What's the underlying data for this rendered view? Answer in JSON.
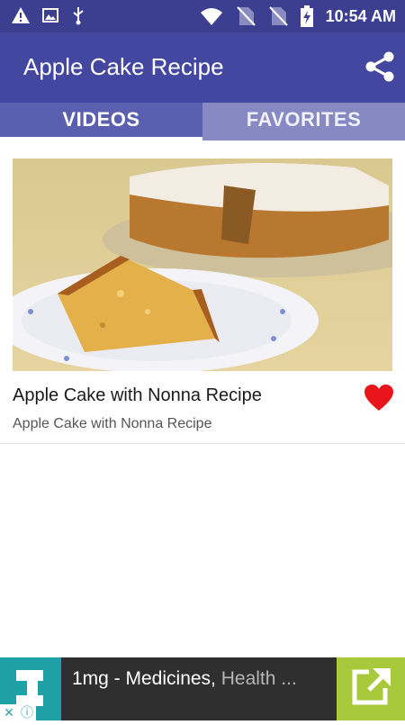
{
  "status_bar": {
    "time": "10:54 AM",
    "left_icons": [
      "alert-icon",
      "image-icon",
      "usb-icon"
    ],
    "right_icons": [
      "wifi-icon",
      "no-sim-icon",
      "no-sim-icon",
      "battery-charging-icon"
    ]
  },
  "app_bar": {
    "title": "Apple Cake Recipe",
    "share_icon": "share-icon",
    "color": "#4347a0"
  },
  "tabs": [
    {
      "label": "VIDEOS",
      "active": true
    },
    {
      "label": "FAVORITES",
      "active": false
    }
  ],
  "videos": [
    {
      "title": "Apple Cake with Nonna Recipe",
      "subtitle": "Apple Cake with Nonna Recipe",
      "favorite": true,
      "favorite_color": "#e8151b"
    }
  ],
  "ad": {
    "text_main": "1mg - Medicines, ",
    "text_fade": "Health ...",
    "open_icon": "open-external-icon",
    "close_icon": "close-icon",
    "info_icon": "info-icon"
  }
}
